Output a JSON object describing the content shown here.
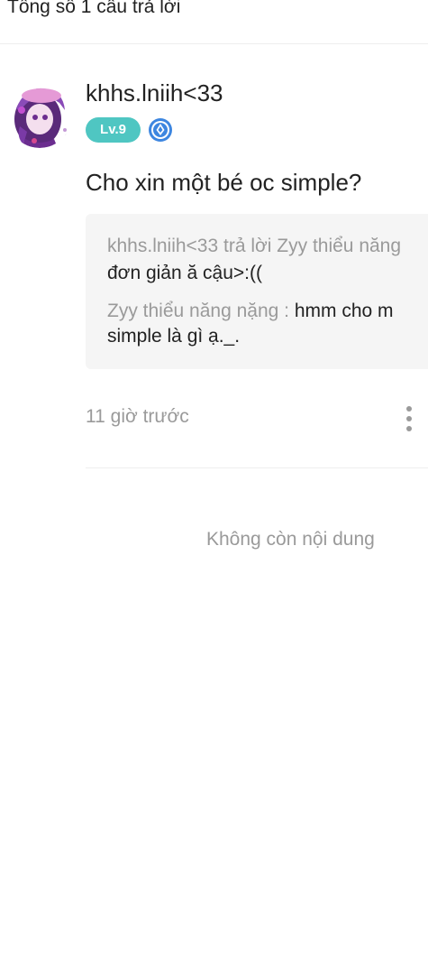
{
  "header": {
    "title": "Tổng số 1 câu trả lời"
  },
  "answer": {
    "username": "khhs.lniih<33",
    "level": "Lv.9",
    "question": "Cho xin một bé oc simple?",
    "quote": {
      "line1": "khhs.lniih<33 trả lời Zyy thiểu năng",
      "line2": "đơn giản ă cậu>:((",
      "reply_author": "Zyy thiểu năng nặng : ",
      "reply_text_1": "hmm cho m",
      "reply_text_2": "simple là gì ạ._."
    },
    "time": "11 giờ trước"
  },
  "footer": {
    "no_more": "Không còn nội dung"
  },
  "colors": {
    "level_badge": "#4fc6c2",
    "verify_badge": "#3d86e0",
    "quote_bg": "#f5f5f5",
    "muted_text": "#9a9a9a"
  },
  "icons": {
    "verify": "verified-badge-icon",
    "more": "more-vertical-icon"
  }
}
